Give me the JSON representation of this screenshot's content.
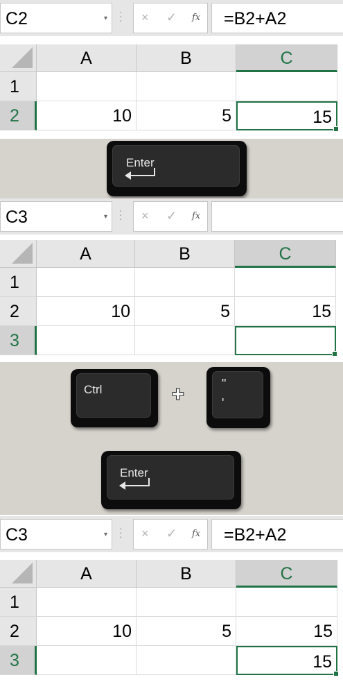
{
  "panels": [
    {
      "namebox": "C2",
      "formula": "=B2+A2",
      "columns": [
        "A",
        "B",
        "C"
      ],
      "selected_column": "C",
      "rows": [
        "1",
        "2"
      ],
      "cells": {
        "A2": "10",
        "B2": "5",
        "C2": "15"
      },
      "active_cell": "C2"
    },
    {
      "namebox": "C3",
      "formula": "",
      "columns": [
        "A",
        "B",
        "C"
      ],
      "selected_column": "C",
      "rows": [
        "1",
        "2",
        "3"
      ],
      "cells": {
        "A2": "10",
        "B2": "5",
        "C2": "15"
      },
      "active_cell": "C3"
    },
    {
      "namebox": "C3",
      "formula": "=B2+A2",
      "columns": [
        "A",
        "B",
        "C"
      ],
      "selected_column": "C",
      "rows": [
        "1",
        "2",
        "3"
      ],
      "cells": {
        "A2": "10",
        "B2": "5",
        "C2": "15",
        "C3": "15"
      },
      "active_cell": "C3"
    }
  ],
  "formula_bar_icons": {
    "cancel": "×",
    "enter": "✓",
    "fx": "fx",
    "dropdown": "▾"
  },
  "keys": {
    "enter_label": "Enter",
    "ctrl_label": "Ctrl",
    "quote_top": "\"",
    "quote_bottom": "'",
    "plus": "+"
  },
  "colors": {
    "accent_green": "#217346",
    "strip_bg": "#d6d2cc",
    "key_black": "#0c0c0c"
  }
}
